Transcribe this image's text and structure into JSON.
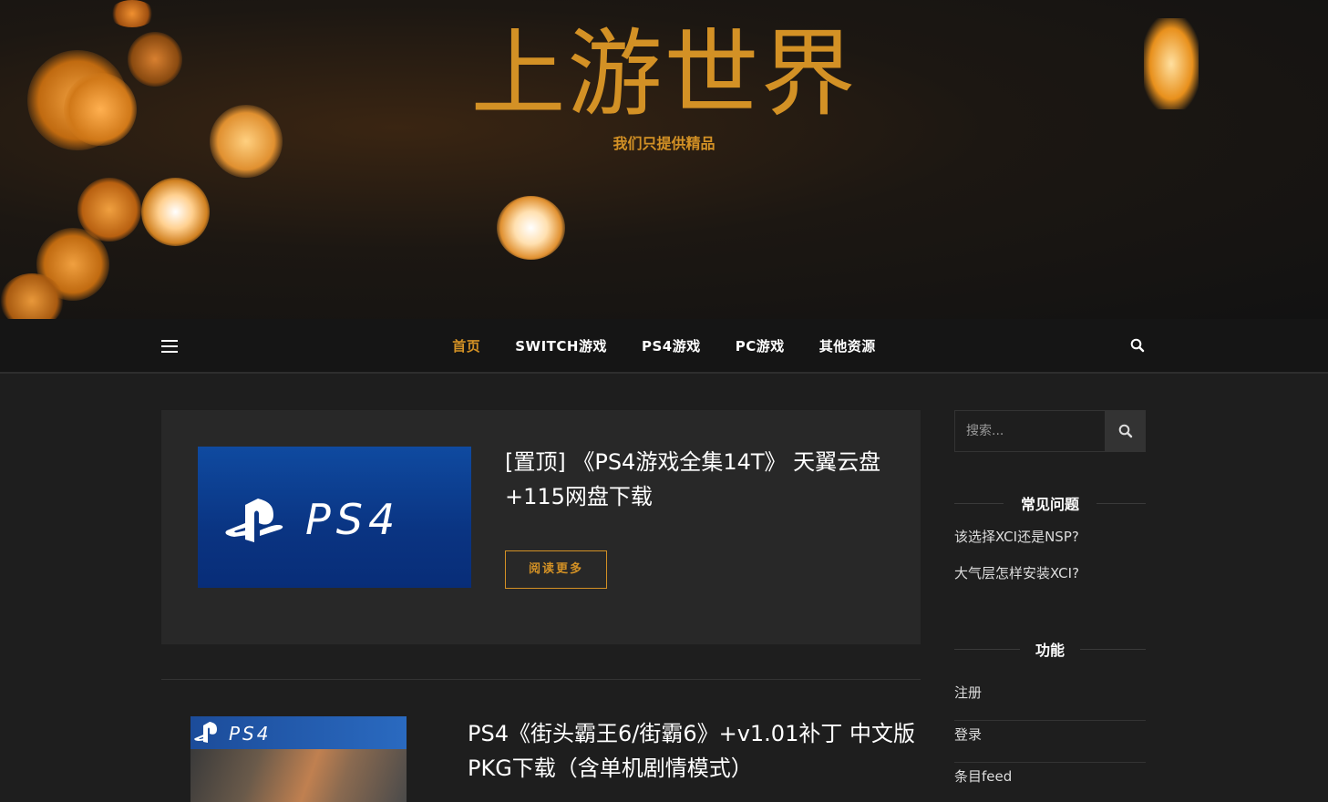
{
  "site": {
    "title": "上游世界",
    "tagline": "我们只提供精品"
  },
  "nav": {
    "items": [
      {
        "label": "首页",
        "active": true
      },
      {
        "label": "SWITCH游戏",
        "active": false
      },
      {
        "label": "PS4游戏",
        "active": false
      },
      {
        "label": "PC游戏",
        "active": false
      },
      {
        "label": "其他资源",
        "active": false
      }
    ]
  },
  "posts": [
    {
      "title": "[置顶] 《PS4游戏全集14T》 天翼云盘+115网盘下载",
      "thumb_logo": "PS4",
      "read_more": "阅读更多"
    },
    {
      "title": "PS4《街头霸王6/街霸6》+v1.01补丁 中文版PKG下载（含单机剧情模式）",
      "thumb_logo": "PS4"
    }
  ],
  "sidebar": {
    "search": {
      "placeholder": "搜索..."
    },
    "faq": {
      "title": "常见问题",
      "links": [
        "该选择XCI还是NSP?",
        "大气层怎样安装XCI?"
      ]
    },
    "functions": {
      "title": "功能",
      "links": [
        "注册",
        "登录",
        "条目feed"
      ]
    }
  },
  "colors": {
    "accent": "#d39125",
    "background": "#1e1e1e",
    "navbar": "#151515",
    "card": "#282828"
  }
}
